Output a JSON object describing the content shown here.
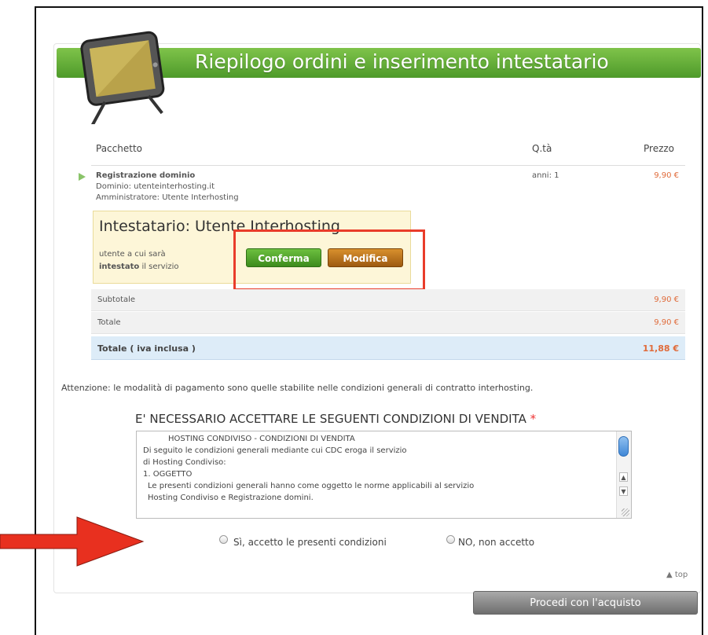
{
  "header": {
    "title": "Riepilogo ordini e inserimento intestatario"
  },
  "columns": {
    "package": "Pacchetto",
    "qty": "Q.tà",
    "price": "Prezzo"
  },
  "item": {
    "name": "Registrazione dominio",
    "domain": "Dominio: utenteinterhosting.it",
    "admin": "Amministratore: Utente Interhosting",
    "qty": "anni: 1",
    "price": "9,90 €"
  },
  "owner": {
    "title": "Intestatario: Utente Interhosting",
    "desc_line1": "utente a cui sarà",
    "desc_bold": "intestato",
    "desc_line2": "il servizio",
    "confirm_label": "Conferma",
    "modify_label": "Modifica"
  },
  "summary": {
    "subtotal_label": "Subtotale",
    "subtotal_value": "9,90 €",
    "total_label": "Totale",
    "total_value": "9,90 €",
    "total_vat_label": "Totale ( iva inclusa )",
    "total_vat_value": "11,88 €"
  },
  "warning": "Attenzione: le modalità di pagamento sono quelle stabilite nelle condizioni generali di contratto interhosting.",
  "conditions": {
    "title": "E' NECESSARIO ACCETTARE LE SEGUENTI CONDIZIONI DI VENDITA",
    "required_mark": "*",
    "lines": [
      "HOSTING CONDIVISO - CONDIZIONI DI VENDITA",
      "Di seguito le condizioni generali mediante cui CDC eroga il servizio",
      "di Hosting Condiviso:",
      "1. OGGETTO",
      "Le presenti condizioni generali hanno come oggetto le norme applicabili al servizio",
      "Hosting Condiviso e Registrazione domini."
    ],
    "accept_label": "Sì, accetto le presenti condizioni",
    "reject_label": "NO, non accetto"
  },
  "footer": {
    "top_link": "top",
    "proceed_label": "Procedi con l'acquisto"
  },
  "colors": {
    "header_green": "#5aa834",
    "confirm_green": "#4f9e2a",
    "modify_orange": "#b86b18",
    "price_orange": "#e06b3a",
    "highlight_red": "#e93c2a"
  }
}
